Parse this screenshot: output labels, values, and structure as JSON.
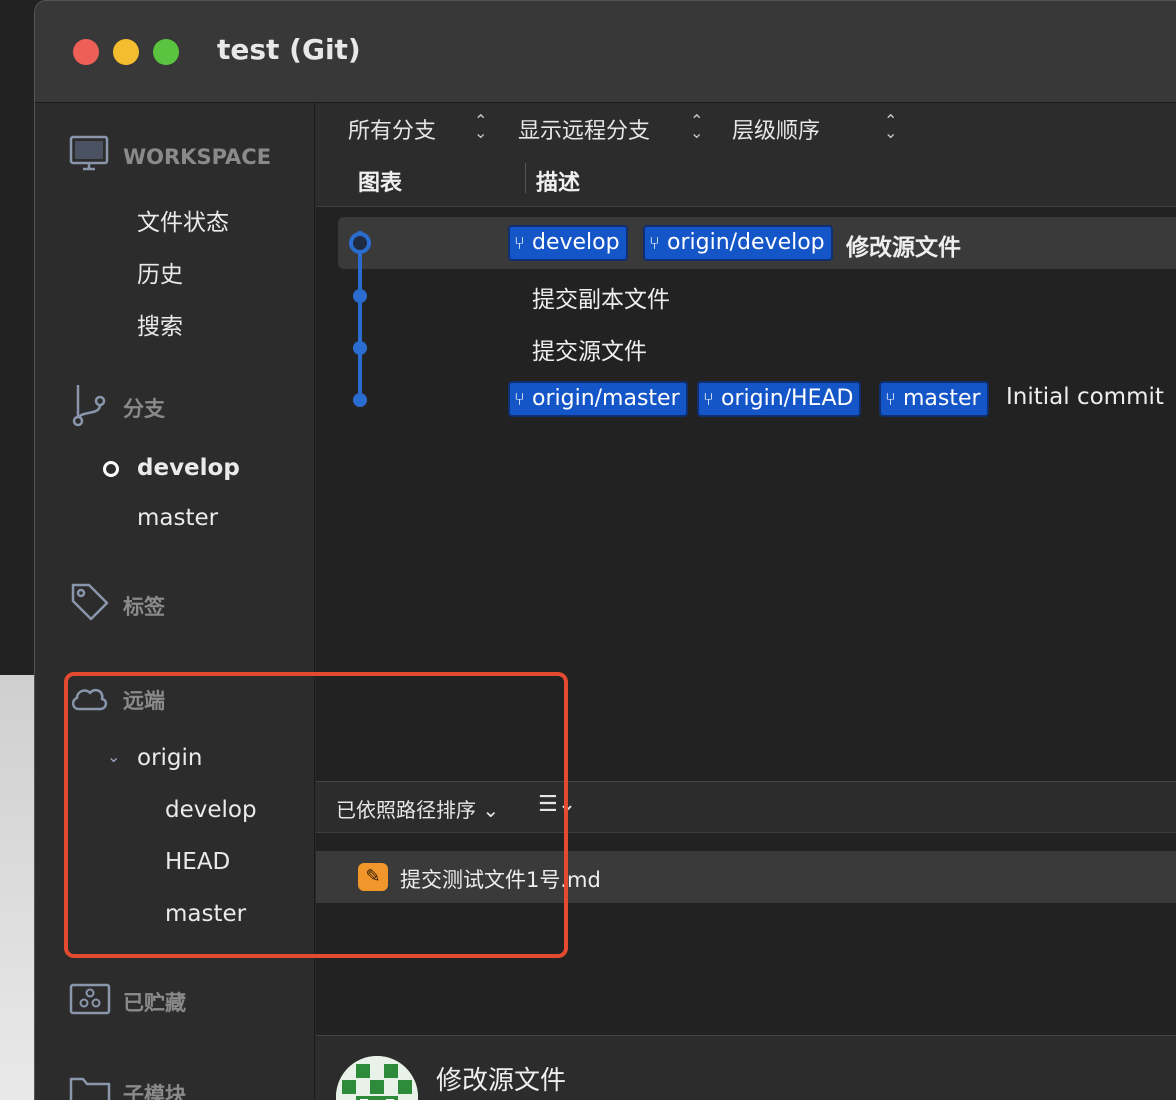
{
  "window": {
    "title": "test (Git)"
  },
  "sidebar": {
    "workspace": {
      "label": "WORKSPACE",
      "icon": "monitor-icon",
      "items": [
        "文件状态",
        "历史",
        "搜索"
      ]
    },
    "branches": {
      "label": "分支",
      "icon": "branch-icon",
      "items": [
        {
          "name": "develop",
          "current": true
        },
        {
          "name": "master",
          "current": false
        }
      ]
    },
    "tags": {
      "label": "标签",
      "icon": "tag-icon"
    },
    "remotes": {
      "label": "远端",
      "icon": "cloud-icon",
      "remote": "origin",
      "items": [
        "develop",
        "HEAD",
        "master"
      ]
    },
    "stashes": {
      "label": "已贮藏",
      "icon": "stash-icon"
    },
    "submodules": {
      "label": "子模块",
      "icon": "folder-icon"
    }
  },
  "filters": {
    "branches": "所有分支",
    "remote": "显示远程分支",
    "order": "层级顺序"
  },
  "columns": {
    "graph": "图表",
    "description": "描述"
  },
  "commits": [
    {
      "badges": [
        "develop",
        "origin/develop"
      ],
      "message": "修改源文件",
      "selected": true
    },
    {
      "badges": [],
      "message": "提交副本文件",
      "selected": false
    },
    {
      "badges": [],
      "message": "提交源文件",
      "selected": false
    },
    {
      "badges": [
        "origin/master",
        "origin/HEAD",
        "master"
      ],
      "message": "Initial commit",
      "selected": false
    }
  ],
  "files_toolbar": {
    "sort_label": "已依照路径排序 ⌄",
    "view_icon": "list-icon"
  },
  "files": [
    {
      "name": "提交测试文件1号.md",
      "status_icon": "modified-pencil-icon"
    }
  ],
  "detail": {
    "title": "修改源文件"
  },
  "colors": {
    "accent": "#1456c7",
    "graph": "#2a6cd0",
    "highlight": "#e34a30",
    "file_modified": "#f0962a"
  }
}
